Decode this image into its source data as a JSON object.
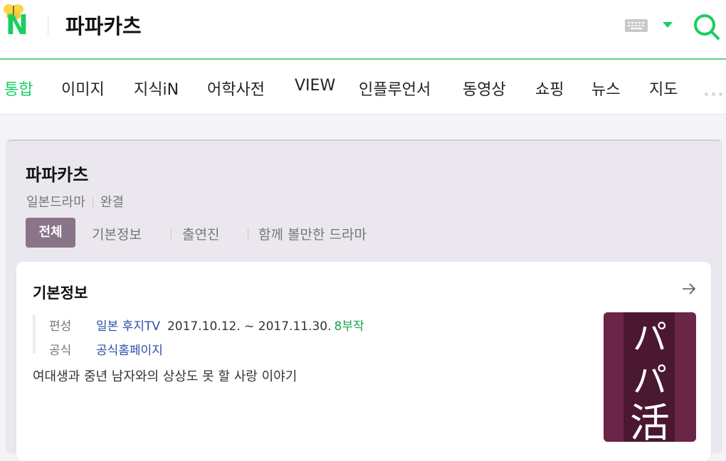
{
  "header": {
    "logo_letter": "N",
    "query": "파파카츠"
  },
  "tabs": [
    "통합",
    "이미지",
    "지식iN",
    "어학사전",
    "VIEW",
    "인플루언서",
    "동영상",
    "쇼핑",
    "뉴스",
    "지도"
  ],
  "active_tab_index": 0,
  "panel": {
    "title": "파파카츠",
    "genre": "일본드라마",
    "status": "완결",
    "subtabs": [
      "전체",
      "기본정보",
      "출연진",
      "함께 볼만한 드라마"
    ]
  },
  "basic_info": {
    "title": "기본정보",
    "rows": {
      "broadcast_label": "편성",
      "broadcaster": "일본 후지TV",
      "dates": "2017.10.12. ~ 2017.11.30.",
      "episodes": "8부작",
      "official_label": "공식",
      "official_link": "공식홈페이지"
    },
    "description": "여대생과 중년 남자와의 상상도 못 할 사랑 이야기",
    "poster_text": [
      "パ",
      "パ",
      "活"
    ]
  },
  "colors": {
    "accent_green": "#19ce60",
    "panel_bg": "#ebe7ee",
    "subtab_active_bg": "#8a7488",
    "link_blue": "#2a4fa8",
    "poster_bg": "#6b2546"
  }
}
